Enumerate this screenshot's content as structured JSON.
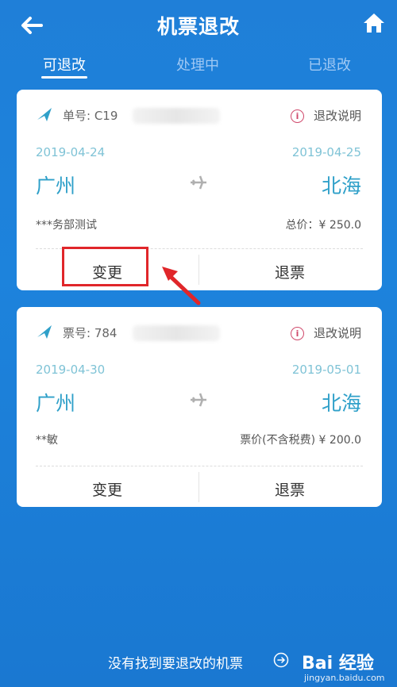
{
  "header": {
    "title": "机票退改"
  },
  "tabs": [
    "可退改",
    "处理中",
    "已退改"
  ],
  "cards": [
    {
      "order_label": "单号: C19",
      "explain": "退改说明",
      "date_from": "2019-04-24",
      "date_to": "2019-04-25",
      "city_from": "广州",
      "city_to": "北海",
      "passenger": "***务部测试",
      "price": "总价：¥ 250.0",
      "change": "变更",
      "refund": "退票"
    },
    {
      "order_label": "票号: 784",
      "explain": "退改说明",
      "date_from": "2019-04-30",
      "date_to": "2019-05-01",
      "city_from": "广州",
      "city_to": "北海",
      "passenger": "**敏",
      "price": "票价(不含税费) ¥ 200.0",
      "change": "变更",
      "refund": "退票"
    }
  ],
  "footer": {
    "link": "没有找到要退改的机票"
  },
  "watermark": {
    "brand": "Bai 经验",
    "url": "jingyan.baidu.com"
  },
  "colors": {
    "accent": "#1f7fd8",
    "city": "#2fa0c9",
    "annotation": "#e0262a"
  },
  "icons": [
    "back-arrow-icon",
    "home-icon",
    "airline-logo-icon",
    "info-icon",
    "plane-icon",
    "arrow-circle-right-icon"
  ]
}
